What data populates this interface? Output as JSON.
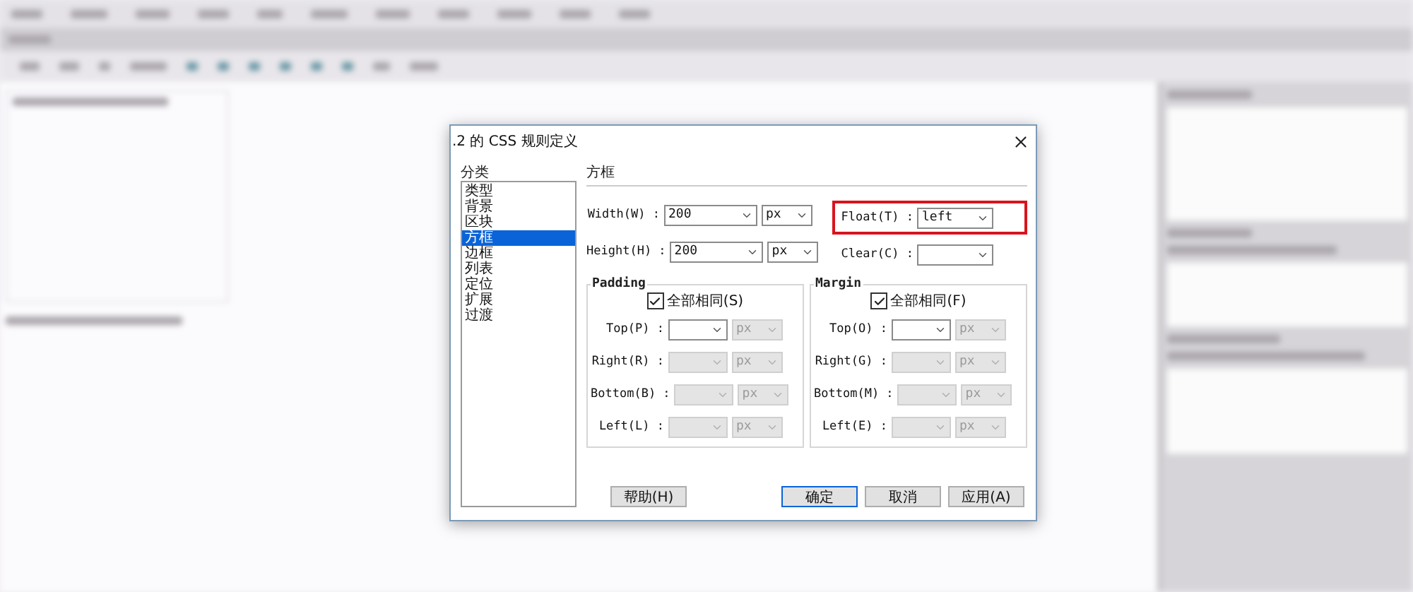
{
  "dialog": {
    "title": ".2 的 CSS 规则定义",
    "category_label": "分类",
    "categories": [
      {
        "label": "类型",
        "selected": false
      },
      {
        "label": "背景",
        "selected": false
      },
      {
        "label": "区块",
        "selected": false
      },
      {
        "label": "方框",
        "selected": true
      },
      {
        "label": "边框",
        "selected": false
      },
      {
        "label": "列表",
        "selected": false
      },
      {
        "label": "定位",
        "selected": false
      },
      {
        "label": "扩展",
        "selected": false
      },
      {
        "label": "过渡",
        "selected": false
      }
    ],
    "section_title": "方框",
    "size_fields": [
      {
        "label": "Width(W) :",
        "value": "200",
        "unit": "px"
      },
      {
        "label": "Height(H) :",
        "value": "200",
        "unit": "px"
      }
    ],
    "position_fields": [
      {
        "label": "Float(T) :",
        "value": "left",
        "highlighted": true
      },
      {
        "label": "Clear(C) :",
        "highlighted": false
      }
    ],
    "groups": [
      {
        "title": "Padding",
        "same_for_all": {
          "label": "全部相同(S)",
          "checked": true
        },
        "sides": [
          {
            "label": "Top(P) :",
            "unit": "px",
            "disabled": false
          },
          {
            "label": "Right(R) :",
            "unit": "px",
            "disabled": true
          },
          {
            "label": "Bottom(B) :",
            "unit": "px",
            "disabled": true
          },
          {
            "label": "Left(L) :",
            "unit": "px",
            "disabled": true
          }
        ]
      },
      {
        "title": "Margin",
        "same_for_all": {
          "label": "全部相同(F)",
          "checked": true
        },
        "sides": [
          {
            "label": "Top(O) :",
            "unit": "px",
            "disabled": false
          },
          {
            "label": "Right(G) :",
            "unit": "px",
            "disabled": true
          },
          {
            "label": "Bottom(M) :",
            "unit": "px",
            "disabled": true
          },
          {
            "label": "Left(E) :",
            "unit": "px",
            "disabled": true
          }
        ]
      }
    ],
    "help_button": {
      "label": "帮助(H)"
    },
    "buttons": [
      {
        "label": "确定",
        "default": true
      },
      {
        "label": "取消",
        "default": false
      },
      {
        "label": "应用(A)",
        "default": false
      }
    ]
  }
}
